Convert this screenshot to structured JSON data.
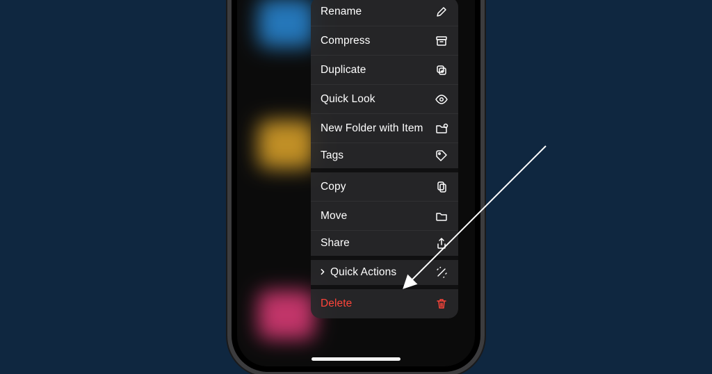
{
  "menu": {
    "items": [
      {
        "label": "Rename",
        "icon": "pencil",
        "section_end": false
      },
      {
        "label": "Compress",
        "icon": "archivebox",
        "section_end": false
      },
      {
        "label": "Duplicate",
        "icon": "duplicate",
        "section_end": false
      },
      {
        "label": "Quick Look",
        "icon": "eye",
        "section_end": false
      },
      {
        "label": "New Folder with Item",
        "icon": "folder-plus",
        "section_end": false
      },
      {
        "label": "Tags",
        "icon": "tag",
        "section_end": true
      },
      {
        "label": "Copy",
        "icon": "copy-doc",
        "section_end": false
      },
      {
        "label": "Move",
        "icon": "folder",
        "section_end": false
      },
      {
        "label": "Share",
        "icon": "share",
        "section_end": true
      },
      {
        "label": "Quick Actions",
        "icon": "wand",
        "submenu": true,
        "section_end": true
      },
      {
        "label": "Delete",
        "icon": "trash",
        "destructive": true,
        "section_end": false
      }
    ]
  },
  "annotation": {
    "arrow_points_to": "Quick Actions"
  },
  "colors": {
    "background": "#0f2740",
    "menu_bg": "rgba(40,40,42,0.92)",
    "destructive": "#ff453a"
  }
}
